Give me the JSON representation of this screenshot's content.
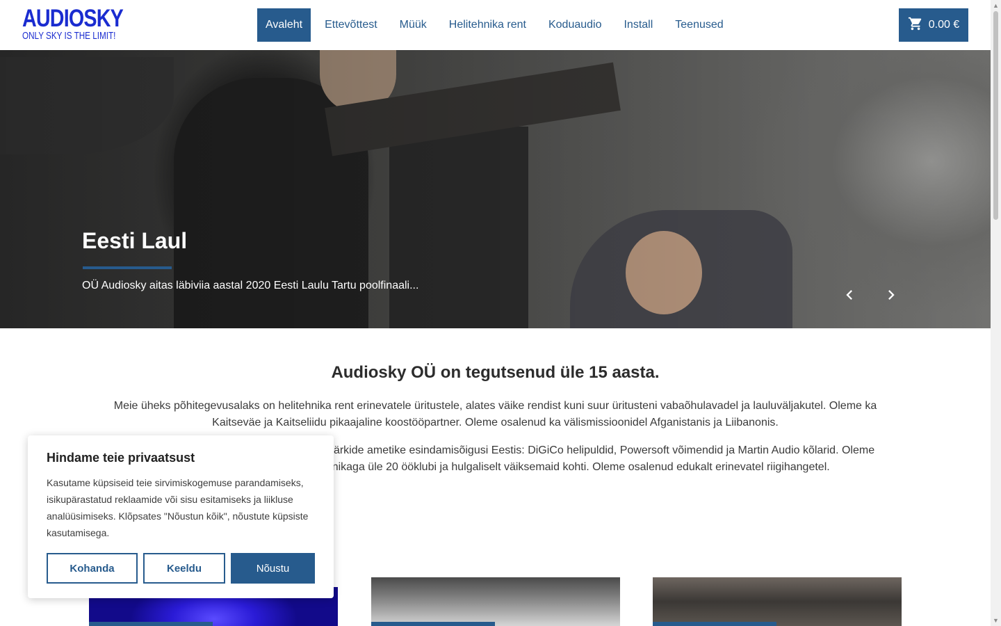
{
  "brand": {
    "name": "AUDIOSKY",
    "tagline": "ONLY SKY IS THE LIMIT!",
    "accent": "#275b8d",
    "logo_color": "#1a2cd0"
  },
  "nav": {
    "items": [
      {
        "label": "Avaleht",
        "active": true
      },
      {
        "label": "Ettevõttest",
        "active": false
      },
      {
        "label": "Müük",
        "active": false
      },
      {
        "label": "Helitehnika rent",
        "active": false
      },
      {
        "label": "Koduaudio",
        "active": false
      },
      {
        "label": "Install",
        "active": false
      },
      {
        "label": "Teenused",
        "active": false
      }
    ],
    "cart": {
      "icon": "cart-icon",
      "total": "0.00 €"
    }
  },
  "hero": {
    "title": "Eesti Laul",
    "text": "OÜ Audiosky aitas läbiviia aastal 2020 Eesti Laulu Tartu poolfinaali...",
    "prev_icon": "chevron-left-icon",
    "next_icon": "chevron-right-icon"
  },
  "about": {
    "title": "Audiosky OÜ on tegutsenud üle 15 aasta.",
    "p1": "Meie üheks põhitegevusalaks on helitehnika rent erinevatele üritustele, alates väike rendist kuni suur üritusteni vabaõhulavadel ja lauluväljakutel. Oleme ka Kaitseväe ja Kaitseliidu pikaajaline koostööpartner. Oleme osalenud ka välismissioonidel Afganistanis ja Liibanonis.",
    "p2": "Oleme Eestis esindades järgnevate kaubamärkide ametike esindamisõigusi Eestis: DiGiCo helipuldid, Powersoft võimendid ja Martin Audio kõlarid. Oleme installeerinud ja varustanud helitehnikaga üle 20 ööklubi ja hulgaliselt väiksemaid kohti. Oleme osalenud edukalt erinevatel riigihangetel."
  },
  "cookie": {
    "title": "Hindame teie privaatsust",
    "text": "Kasutame küpsiseid teie sirvimiskogemuse parandamiseks, isikupärastatud reklaamide või sisu esitamiseks ja liikluse analüüsimiseks. Klõpsates \"Nõustun kõik\", nõustute küpsiste kasutamisega.",
    "customize": "Kohanda",
    "reject": "Keeldu",
    "accept": "Nõustu"
  }
}
